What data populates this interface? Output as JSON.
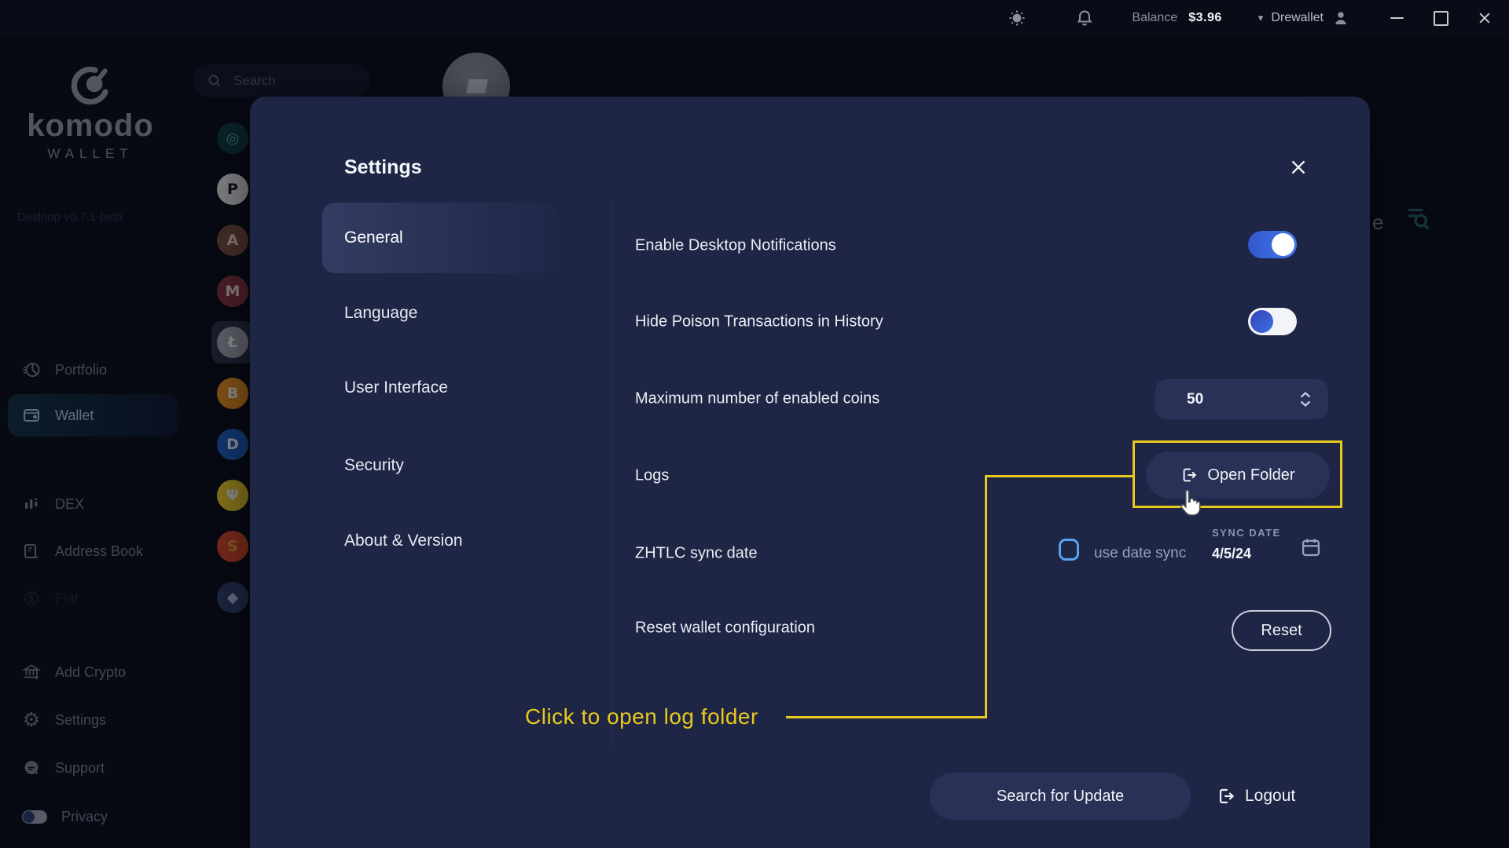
{
  "topbar": {
    "balance_label": "Balance",
    "balance_value": "$3.96",
    "account_name": "Drewallet"
  },
  "brand": {
    "name": "komodo",
    "subtitle": "WALLET",
    "version": "Desktop v0.7.1-beta"
  },
  "search": {
    "placeholder": "Search"
  },
  "sidebar": {
    "nav": [
      {
        "label": "Portfolio"
      },
      {
        "label": "Wallet"
      },
      {
        "label": "DEX"
      },
      {
        "label": "Address Book"
      },
      {
        "label": "Fiat"
      }
    ],
    "footer": [
      {
        "label": "Add Crypto"
      },
      {
        "label": "Settings"
      },
      {
        "label": "Support"
      },
      {
        "label": "Privacy"
      }
    ]
  },
  "coins": [
    {
      "name": "komodo-coin",
      "bg": "#0f3b43",
      "fg": "#54aab2",
      "glyph": "◎"
    },
    {
      "name": "panda-token",
      "bg": "#ececec",
      "fg": "#16181d",
      "glyph": "P"
    },
    {
      "name": "avatar-token-1",
      "bg": "#7d5242",
      "fg": "#f2dcc8",
      "glyph": "A"
    },
    {
      "name": "avatar-token-2",
      "bg": "#8c3440",
      "fg": "#f4e6e2",
      "glyph": "M"
    },
    {
      "name": "litecoin",
      "bg": "#a9aeb8",
      "fg": "#ffffff",
      "glyph": "Ł",
      "selected": true
    },
    {
      "name": "bitcoin",
      "bg": "#f0921e",
      "fg": "#ffffff",
      "glyph": "B"
    },
    {
      "name": "digibyte",
      "bg": "#1f63c6",
      "fg": "#ffffff",
      "glyph": "D"
    },
    {
      "name": "psi-token",
      "bg": "#f2d028",
      "fg": "#ffffff",
      "glyph": "Ψ"
    },
    {
      "name": "shiba-token",
      "bg": "#dd4a2b",
      "fg": "#f6a83e",
      "glyph": "S"
    },
    {
      "name": "ethereum",
      "bg": "#32406e",
      "fg": "#b8c2ec",
      "glyph": "◆"
    }
  ],
  "background_fragment": {
    "text": "e"
  },
  "modal": {
    "title": "Settings",
    "tabs": [
      {
        "label": "General"
      },
      {
        "label": "Language"
      },
      {
        "label": "User Interface"
      },
      {
        "label": "Security"
      },
      {
        "label": "About & Version"
      }
    ],
    "rows": {
      "notifications": {
        "label": "Enable Desktop Notifications",
        "state": "on"
      },
      "poison": {
        "label": "Hide Poison Transactions in History",
        "state": "on"
      },
      "max_coins": {
        "label": "Maximum number of enabled coins",
        "value": "50"
      },
      "logs": {
        "label": "Logs",
        "button_label": "Open Folder"
      },
      "zhtlc": {
        "label": "ZHTLC sync date",
        "checkbox_label": "use date sync",
        "checkbox_checked": false,
        "sync_date_label": "SYNC DATE",
        "sync_date_value": "4/5/24"
      },
      "reset": {
        "label": "Reset wallet configuration",
        "button_label": "Reset"
      }
    },
    "footer": {
      "update_label": "Search for Update",
      "logout_label": "Logout"
    }
  },
  "annotation": {
    "text": "Click to open log folder",
    "color": "#e8c91d"
  },
  "icons": {
    "sun-icon": "theme toggle",
    "bell-icon": "notifications",
    "person-icon": "account",
    "caret-down-icon": "▾",
    "minimize-icon": "—",
    "maximize-icon": "□",
    "close-icon": "✕",
    "search-icon": "magnifier",
    "gear-icon": "⚙",
    "export-icon": "box-arrow-right",
    "calendar-icon": "calendar",
    "stepper-up-icon": "chevron-up",
    "stepper-down-icon": "chevron-down",
    "cursor-icon": "hand-pointer"
  }
}
